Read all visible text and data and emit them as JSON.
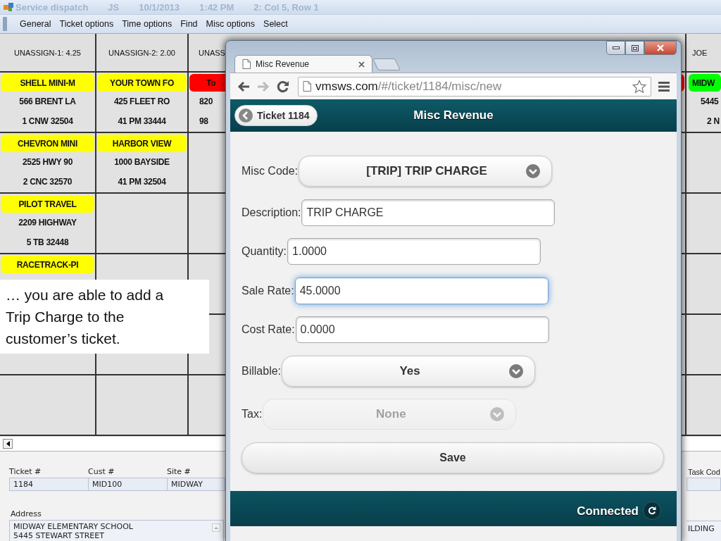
{
  "app": {
    "title": "Service dispatch",
    "user": "JS",
    "date": "10/1/2013",
    "time": "1:42 PM",
    "position": "2: Col 5, Row 1"
  },
  "menu": [
    "General",
    "Ticket options",
    "Time options",
    "Find",
    "Misc options",
    "Select"
  ],
  "board": {
    "columns": [
      {
        "header": "UNASSIGN-1: 4.25",
        "tickets": [
          {
            "name": "SHELL MINI-M",
            "color": "#ffff00",
            "street": "566 BRENT LA",
            "city_line": "1 CNW 32504"
          },
          {
            "name": "CHEVRON MINI",
            "color": "#ffff00",
            "street": "2525 HWY 90",
            "city_line": "2 CNC 32570"
          },
          {
            "name": "PILOT TRAVEL",
            "color": "#ffff00",
            "street": "2209 HIGHWAY",
            "city_line": "5 TB 32448"
          },
          {
            "name": "RACETRACK-PI",
            "color": "#ffff00"
          }
        ]
      },
      {
        "header": "UNASSIGN-2: 2.00",
        "tickets": [
          {
            "name": "YOUR TOWN FO",
            "color": "#ffff00",
            "street": "425 FLEET RO",
            "city_line": "41 PM 33444"
          },
          {
            "name": "HARBOR VIEW",
            "color": "#ffff00",
            "street": "1000 BAYSIDE",
            "city_line": "41 PM 32504"
          }
        ]
      },
      {
        "header": "UNASS",
        "tickets": [
          {
            "name": "To",
            "color": "#ff0000",
            "street": "820",
            "city_line": "98"
          }
        ]
      },
      {
        "header": "JOE",
        "tickets": [
          {
            "name": "MIDW",
            "color": "#00ff00",
            "street": "5445",
            "city_line": "2 N"
          }
        ]
      }
    ]
  },
  "details": {
    "fields": [
      {
        "label": "Ticket #",
        "value": "1184"
      },
      {
        "label": "Cust #",
        "value": "MID100"
      },
      {
        "label": "Site #",
        "value": "MIDWAY"
      }
    ],
    "address": {
      "label": "Address",
      "lines": [
        "MIDWAY ELEMENTARY SCHOOL",
        "5445 STEWART STREET"
      ]
    },
    "right_label": "Task Cod",
    "right_address": "ILDING"
  },
  "callout": {
    "text": "… you are able to add a Trip Charge to the customer’s ticket."
  },
  "browser": {
    "tab_title": "Misc Revenue",
    "url_host": "vmsws.com",
    "url_path": "/#/ticket/1184/misc/new",
    "page": {
      "back_button": "Ticket 1184",
      "title": "Misc Revenue",
      "form": [
        {
          "kind": "select",
          "label": "Misc Code:",
          "value": "[TRIP] TRIP CHARGE",
          "disabled": false
        },
        {
          "kind": "input",
          "label": "Description:",
          "value": "TRIP CHARGE",
          "focused": false
        },
        {
          "kind": "input",
          "label": "Quantity:",
          "value": "1.0000",
          "focused": false
        },
        {
          "kind": "input",
          "label": "Sale Rate:",
          "value": "45.0000",
          "focused": true
        },
        {
          "kind": "input",
          "label": "Cost Rate:",
          "value": "0.0000",
          "focused": false
        },
        {
          "kind": "select",
          "label": "Billable:",
          "value": "Yes",
          "disabled": false
        },
        {
          "kind": "select",
          "label": "Tax:",
          "value": "None",
          "disabled": true
        }
      ],
      "save": "Save",
      "status": "Connected"
    }
  }
}
